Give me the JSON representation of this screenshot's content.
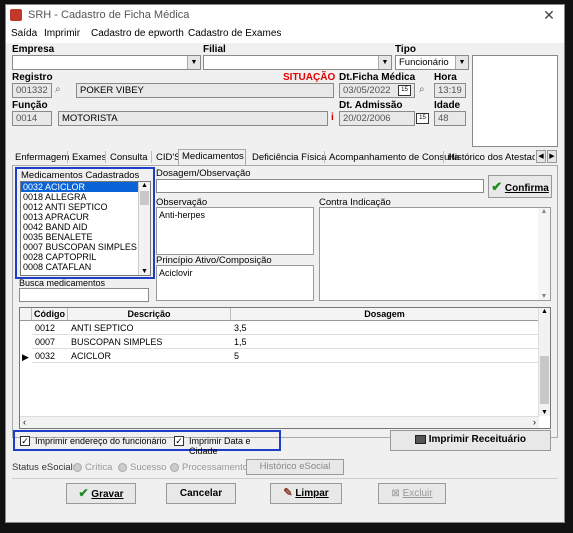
{
  "window": {
    "title": "SRH - Cadastro de Ficha Médica",
    "close_glyph": "✕"
  },
  "menu": [
    "Saída",
    "Imprimir",
    "Cadastro de epworth",
    "Cadastro de Exames"
  ],
  "header": {
    "empresa_label": "Empresa",
    "filial_label": "Filial",
    "tipo_label": "Tipo",
    "tipo_value": "Funcionário",
    "registro_label": "Registro",
    "registro_code": "001332",
    "registro_name": "POKER VIBEY",
    "situacao_label": "SITUAÇÃO",
    "dt_ficha_label": "Dt.Ficha Médica",
    "dt_ficha_value": "03/05/2022",
    "hora_label": "Hora",
    "hora_value": "13:19",
    "funcao_label": "Função",
    "funcao_code": "0014",
    "funcao_name": "MOTORISTA",
    "dt_admissao_label": "Dt. Admissão",
    "dt_admissao_value": "20/02/2006",
    "idade_label": "Idade",
    "idade_value": "48",
    "info_glyph": "i"
  },
  "tabs": [
    "Enfermagem",
    "Exames",
    "Consulta",
    "CID'S",
    "Medicamentos",
    "Deficiência Física",
    "Acompanhamento de Consulta",
    "Histórico dos Atestados"
  ],
  "active_tab": "Medicamentos",
  "medicamentos": {
    "list_label": "Medicamentos Cadastrados",
    "items": [
      "0032 ACICLOR",
      "0018 ALLEGRA",
      "0012 ANTI SEPTICO",
      "0013 APRACUR",
      "0042 BAND AID",
      "0035 BENALETE",
      "0007 BUSCOPAN SIMPLES",
      "0028 CAPTOPRIL",
      "0008 CATAFLAN"
    ],
    "busca_label": "Busca medicamentos",
    "dosagem_obs_label": "Dosagem/Observação",
    "observacao_label": "Observação",
    "observacao_value": "Anti-herpes",
    "principio_label": "Princípio Ativo/Composição",
    "principio_value": "Aciclovir",
    "contra_label": "Contra Indicação",
    "confirma_label": "Confirma"
  },
  "grid": {
    "headers": [
      "Código",
      "Descrição",
      "Dosagem"
    ],
    "rows": [
      {
        "codigo": "0012",
        "descricao": "ANTI SEPTICO",
        "dosagem": "3,5"
      },
      {
        "codigo": "0007",
        "descricao": "BUSCOPAN SIMPLES",
        "dosagem": "1,5"
      },
      {
        "codigo": "0032",
        "descricao": "ACICLOR",
        "dosagem": "5"
      }
    ]
  },
  "options": {
    "imprimir_endereco": "Imprimir endereço do funcionário",
    "imprimir_data": "Imprimir Data e Cidade",
    "imprimir_receituario": "Imprimir Receituário"
  },
  "status": {
    "label": "Status eSocial:",
    "critica": "Crítica",
    "sucesso": "Sucesso",
    "processamento": "Processamento",
    "historico_btn": "Histórico eSocial"
  },
  "footer": {
    "gravar": "Gravar",
    "cancelar": "Cancelar",
    "limpar": "Limpar",
    "excluir": "Excluir"
  },
  "colors": {
    "accent_blue": "#1f3ec8",
    "situacao_red": "#e00000",
    "confirma_green": "#1e8c1e"
  }
}
